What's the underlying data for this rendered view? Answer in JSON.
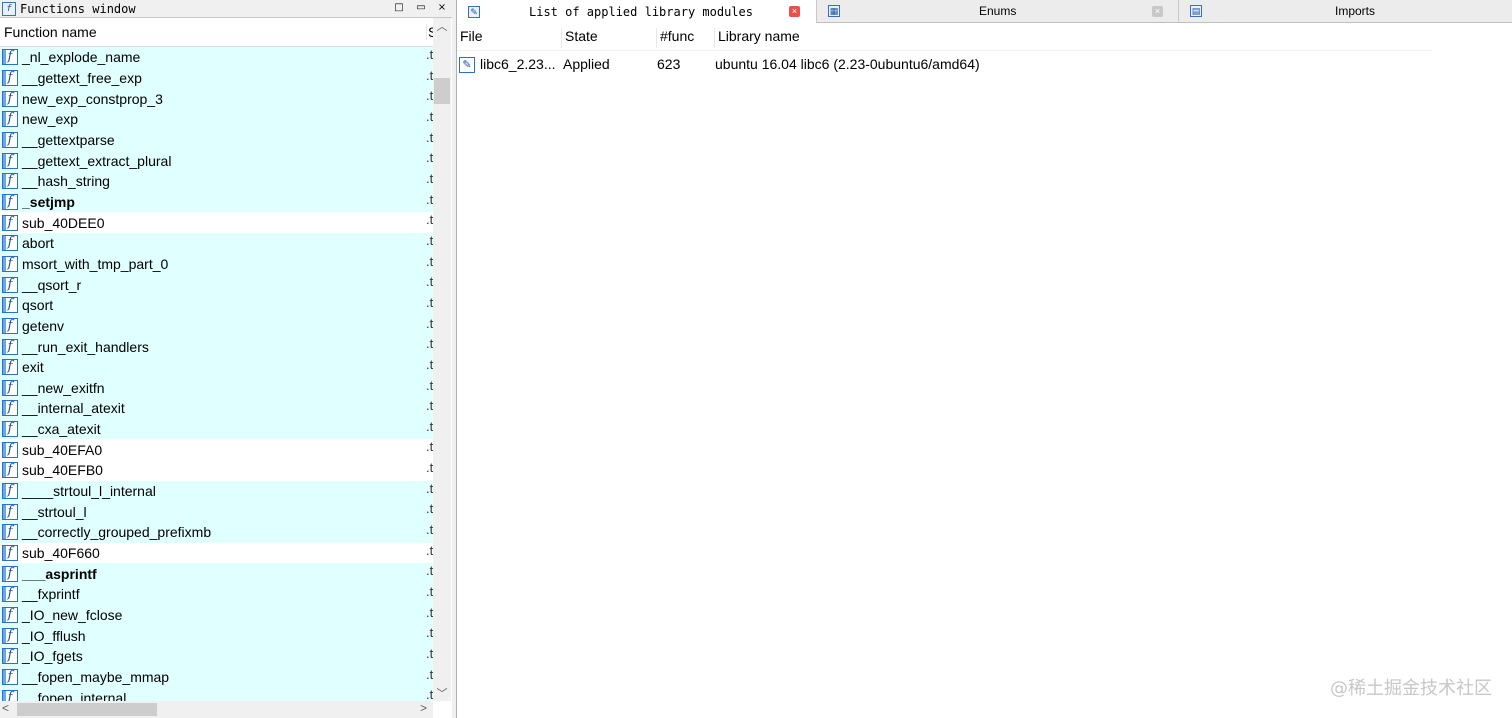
{
  "functions_window": {
    "title": "Functions window",
    "column_name": "Function name",
    "column_segment": "S",
    "title_buttons": [
      "□",
      "▭",
      "×"
    ],
    "rows": [
      {
        "name": "_nl_explode_name",
        "seg": ".t",
        "bold": false,
        "highlight": true
      },
      {
        "name": "__gettext_free_exp",
        "seg": ".t",
        "bold": false,
        "highlight": true
      },
      {
        "name": "new_exp_constprop_3",
        "seg": ".t",
        "bold": false,
        "highlight": true
      },
      {
        "name": "new_exp",
        "seg": ".t",
        "bold": false,
        "highlight": true
      },
      {
        "name": "__gettextparse",
        "seg": ".t",
        "bold": false,
        "highlight": true
      },
      {
        "name": "__gettext_extract_plural",
        "seg": ".t",
        "bold": false,
        "highlight": true
      },
      {
        "name": "__hash_string",
        "seg": ".t",
        "bold": false,
        "highlight": true
      },
      {
        "name": "_setjmp",
        "seg": ".t",
        "bold": true,
        "highlight": true
      },
      {
        "name": "sub_40DEE0",
        "seg": ".t",
        "bold": false,
        "highlight": false
      },
      {
        "name": "abort",
        "seg": ".t",
        "bold": false,
        "highlight": true
      },
      {
        "name": "msort_with_tmp_part_0",
        "seg": ".t",
        "bold": false,
        "highlight": true
      },
      {
        "name": "__qsort_r",
        "seg": ".t",
        "bold": false,
        "highlight": true
      },
      {
        "name": "qsort",
        "seg": ".t",
        "bold": false,
        "highlight": true
      },
      {
        "name": "getenv",
        "seg": ".t",
        "bold": false,
        "highlight": true
      },
      {
        "name": "__run_exit_handlers",
        "seg": ".t",
        "bold": false,
        "highlight": true
      },
      {
        "name": "exit",
        "seg": ".t",
        "bold": false,
        "highlight": true
      },
      {
        "name": "__new_exitfn",
        "seg": ".t",
        "bold": false,
        "highlight": true
      },
      {
        "name": "__internal_atexit",
        "seg": ".t",
        "bold": false,
        "highlight": true
      },
      {
        "name": "__cxa_atexit",
        "seg": ".t",
        "bold": false,
        "highlight": true
      },
      {
        "name": "sub_40EFA0",
        "seg": ".t",
        "bold": false,
        "highlight": false
      },
      {
        "name": "sub_40EFB0",
        "seg": ".t",
        "bold": false,
        "highlight": false
      },
      {
        "name": "____strtoul_l_internal",
        "seg": ".t",
        "bold": false,
        "highlight": true
      },
      {
        "name": "__strtoul_l",
        "seg": ".t",
        "bold": false,
        "highlight": true
      },
      {
        "name": "__correctly_grouped_prefixmb",
        "seg": ".t",
        "bold": false,
        "highlight": true
      },
      {
        "name": "sub_40F660",
        "seg": ".t",
        "bold": false,
        "highlight": false
      },
      {
        "name": "___asprintf",
        "seg": ".t",
        "bold": true,
        "highlight": true
      },
      {
        "name": "__fxprintf",
        "seg": ".t",
        "bold": false,
        "highlight": true
      },
      {
        "name": "_IO_new_fclose",
        "seg": ".t",
        "bold": false,
        "highlight": true
      },
      {
        "name": "_IO_fflush",
        "seg": ".t",
        "bold": false,
        "highlight": true
      },
      {
        "name": "_IO_fgets",
        "seg": ".t",
        "bold": false,
        "highlight": true
      },
      {
        "name": "__fopen_maybe_mmap",
        "seg": ".t",
        "bold": false,
        "highlight": true
      },
      {
        "name": "__fopen_internal",
        "seg": ".t",
        "bold": false,
        "highlight": true
      }
    ]
  },
  "tabs": [
    {
      "label": "List of applied library modules",
      "active": true,
      "close": "red"
    },
    {
      "label": "Enums",
      "active": false,
      "close": "grey"
    },
    {
      "label": "Imports",
      "active": false,
      "close": ""
    }
  ],
  "library_modules": {
    "headers": [
      "File",
      "State",
      "#func",
      "Library name"
    ],
    "rows": [
      {
        "file": "libc6_2.23...",
        "state": "Applied",
        "func": "623",
        "library": "ubuntu 16.04 libc6 (2.23-0ubuntu6/amd64)"
      }
    ]
  },
  "watermark": "@稀土掘金技术社区",
  "colors": {
    "row_highlight": "#e0ffff",
    "icon_blue": "#2a6fc9",
    "tab_close_red": "#e8524a"
  }
}
